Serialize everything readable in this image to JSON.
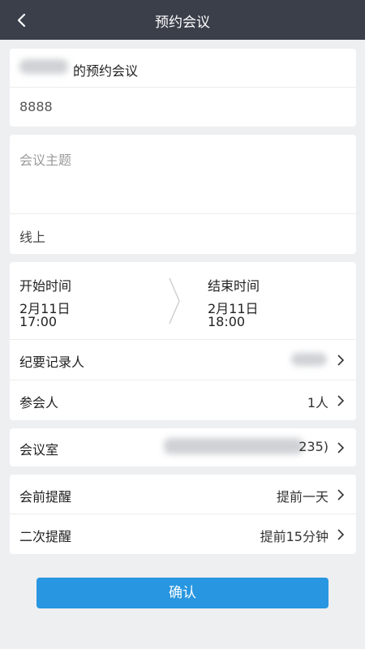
{
  "nav": {
    "title": "预约会议"
  },
  "info": {
    "owner_suffix": "的预约会议",
    "meeting_code": "8888"
  },
  "subject": {
    "placeholder": "会议主题",
    "location": "线上"
  },
  "time": {
    "start_label": "开始时间",
    "start_date": "2月11日",
    "start_time": "17:00",
    "end_label": "结束时间",
    "end_date": "2月11日",
    "end_time": "18:00"
  },
  "people": {
    "recorder_label": "纪要记录人",
    "attendees_label": "参会人",
    "attendees_value": "1人"
  },
  "room": {
    "label": "会议室",
    "value_tail": "235)"
  },
  "reminders": {
    "pre_label": "会前提醒",
    "pre_value": "提前一天",
    "second_label": "二次提醒",
    "second_value": "提前15分钟"
  },
  "confirm_label": "确认",
  "colors": {
    "nav_bg": "#3a3f4a",
    "accent": "#2896e0",
    "page_bg": "#eeeff1"
  }
}
